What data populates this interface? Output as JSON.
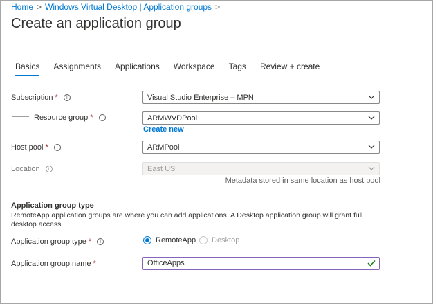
{
  "breadcrumb": {
    "home": "Home",
    "parent": "Windows Virtual Desktop | Application groups",
    "separator": ">"
  },
  "page_title": "Create an application group",
  "tabs": [
    {
      "label": "Basics",
      "active": true
    },
    {
      "label": "Assignments",
      "active": false
    },
    {
      "label": "Applications",
      "active": false
    },
    {
      "label": "Workspace",
      "active": false
    },
    {
      "label": "Tags",
      "active": false
    },
    {
      "label": "Review + create",
      "active": false
    }
  ],
  "form": {
    "subscription": {
      "label": "Subscription",
      "required": "*",
      "info_glyph": "i",
      "value": "Visual Studio Enterprise – MPN"
    },
    "resource_group": {
      "label": "Resource group",
      "required": "*",
      "info_glyph": "i",
      "value": "ARMWVDPool",
      "create_new": "Create new"
    },
    "host_pool": {
      "label": "Host pool",
      "required": "*",
      "info_glyph": "i",
      "value": "ARMPool"
    },
    "location": {
      "label": "Location",
      "info_glyph": "i",
      "value": "East US",
      "hint": "Metadata stored in same location as host pool"
    }
  },
  "app_group_section": {
    "title": "Application group type",
    "description": "RemoteApp application groups are where you can add applications. A Desktop application group will grant full desktop access.",
    "type": {
      "label": "Application group type",
      "required": "*",
      "info_glyph": "i",
      "options": [
        {
          "label": "RemoteApp",
          "selected": true
        },
        {
          "label": "Desktop",
          "selected": false
        }
      ]
    },
    "name": {
      "label": "Application group name",
      "required": "*",
      "value": "OfficeApps"
    }
  },
  "colors": {
    "accent": "#0078d4",
    "required": "#a4262c",
    "valid": "#107c10",
    "focus_border": "#8764b8"
  },
  "icons": {
    "dropdown": "chevron-down-icon",
    "info": "info-icon",
    "valid": "checkmark-icon"
  }
}
